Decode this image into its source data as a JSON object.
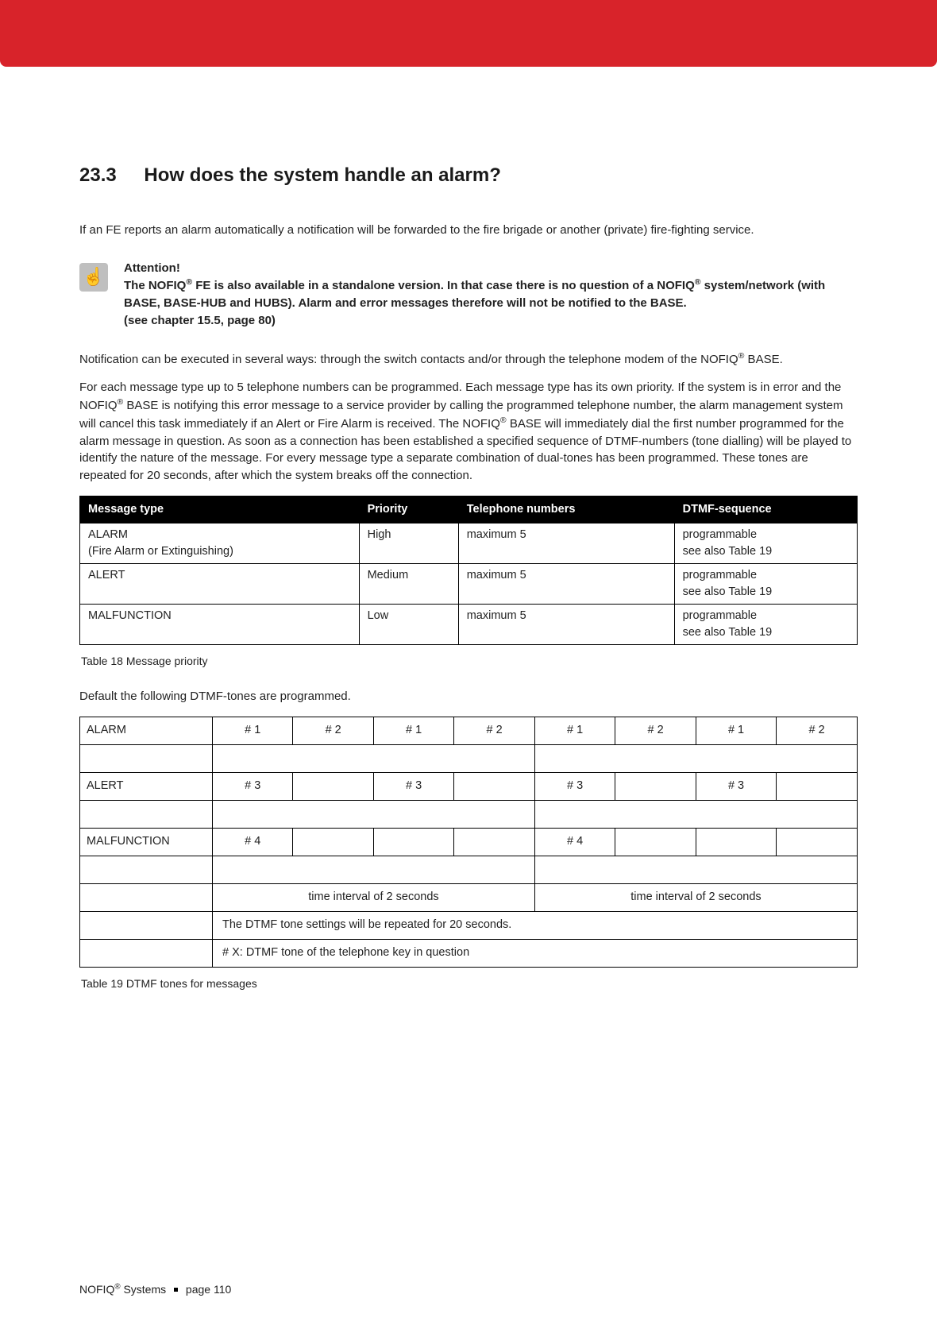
{
  "header": {
    "section_number": "23.3",
    "section_title": "How does the system handle an alarm?"
  },
  "intro_paragraph": "If an FE reports an alarm automatically a notification will be forwarded to the fire brigade or another (private) fire-fighting service.",
  "attention": {
    "heading": "Attention!",
    "line1a": "The NOFIQ",
    "line1b": " FE is also available in a standalone version. In that case there is no question of a NOFIQ",
    "line1c": " system/network (with BASE, BASE-HUB and HUBS). Alarm and error messages therefore will not be notified to the BASE.",
    "line2": "(see chapter 15.5, page 80)"
  },
  "para2a": "Notification can be executed in several ways: through the switch contacts and/or through the telephone modem of the NOFIQ",
  "para2b": " BASE.",
  "para3a": "For each message type up to 5 telephone numbers can be programmed. Each message type has its own priority. If the system is in error and the NOFIQ",
  "para3b": " BASE is notifying this error message to a service provider by calling the programmed telephone number, the alarm management system will cancel this task immediately if an Alert or Fire Alarm is received. The NOFIQ",
  "para3c": " BASE will immediately dial the first number programmed for the alarm message in question. As soon as a connection has been established a specified sequence of DTMF-numbers (tone dialling) will be played to identify the nature of the message. For every message type a separate combination of dual-tones has been programmed. These tones are repeated for 20 seconds, after which the system breaks off the connection.",
  "priority_table": {
    "headers": [
      "Message type",
      "Priority",
      "Telephone numbers",
      "DTMF-sequence"
    ],
    "rows": [
      {
        "type_line1": "ALARM",
        "type_line2": "(Fire Alarm or Extinguishing)",
        "priority": "High",
        "tel": "maximum 5",
        "dtmf_l1": "programmable",
        "dtmf_l2": "see also Table 19"
      },
      {
        "type_line1": "ALERT",
        "type_line2": "",
        "priority": "Medium",
        "tel": "maximum 5",
        "dtmf_l1": "programmable",
        "dtmf_l2": "see also Table 19"
      },
      {
        "type_line1": "MALFUNCTION",
        "type_line2": "",
        "priority": "Low",
        "tel": "maximum 5",
        "dtmf_l1": "programmable",
        "dtmf_l2": "see  also Table 19"
      }
    ],
    "caption": "Table 18 Message priority"
  },
  "dtmf_intro": "Default the following DTMF-tones are programmed.",
  "dtmf_table": {
    "rows": [
      {
        "label": "ALARM",
        "cells": [
          "# 1",
          "# 2",
          "# 1",
          "# 2",
          "# 1",
          "# 2",
          "# 1",
          "# 2"
        ]
      },
      {
        "label": "ALERT",
        "cells": [
          "# 3",
          "",
          "# 3",
          "",
          "# 3",
          "",
          "# 3",
          ""
        ]
      },
      {
        "label": "MALFUNCTION",
        "cells": [
          "# 4",
          "",
          "",
          "",
          "# 4",
          "",
          "",
          ""
        ]
      }
    ],
    "interval_text": "time interval of 2 seconds",
    "note1": "The DTMF tone settings will be repeated for 20 seconds.",
    "note2": "# X: DTMF tone of the telephone key in question",
    "caption": "Table 19 DTMF tones for messages"
  },
  "footer": {
    "brand_a": "NOFIQ",
    "brand_b": " Systems",
    "page": "page 110"
  },
  "reg_mark": "®"
}
